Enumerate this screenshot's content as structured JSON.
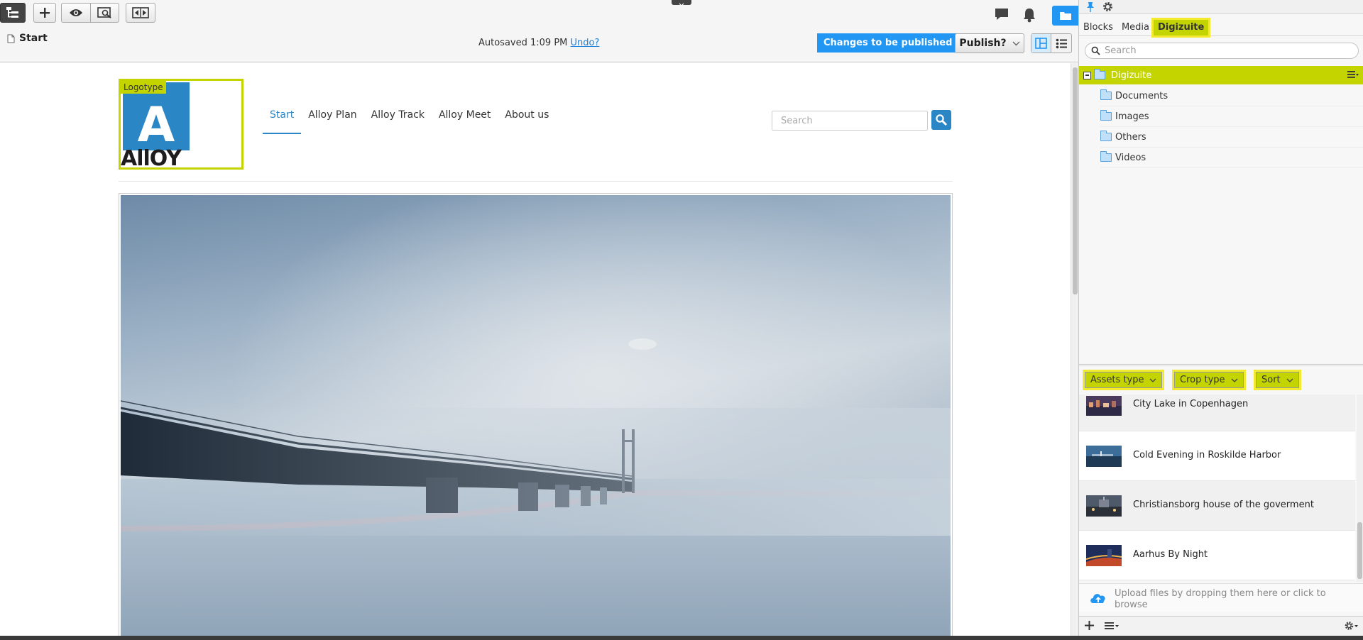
{
  "toolbar": {
    "breadcrumb": "Start",
    "autosaved_text": "Autosaved 1:09 PM",
    "undo_link": "Undo?",
    "changes_badge": "Changes to be published",
    "publish_label": "Publish?",
    "icons": [
      "tree-icon",
      "plus-icon",
      "eye-icon",
      "preview-icon",
      "compare-icon",
      "comment-icon",
      "bell-icon",
      "folder-icon",
      "layout-icon",
      "list-icon",
      "chevron-down-icon"
    ]
  },
  "site": {
    "logo_label": "Logotype",
    "logo_letter": "A",
    "logo_word": "AllOY",
    "nav": [
      "Start",
      "Alloy Plan",
      "Alloy Track",
      "Alloy Meet",
      "About us"
    ],
    "active_nav": "Start",
    "search_placeholder": "Search"
  },
  "panel": {
    "tabs": [
      "Blocks",
      "Media",
      "Digizuite"
    ],
    "active_tab": "Digizuite",
    "search_placeholder": "Search",
    "tree_root": "Digizuite",
    "tree_items": [
      "Documents",
      "Images",
      "Others",
      "Videos"
    ],
    "filters": [
      "Assets type",
      "Crop type",
      "Sort"
    ],
    "assets": [
      {
        "title": "City Lake in Copenhagen"
      },
      {
        "title": "Cold Evening in Roskilde Harbor"
      },
      {
        "title": "Christiansborg house of the goverment"
      },
      {
        "title": "Aarhus By Night"
      }
    ],
    "upload_text": "Upload files by dropping them here or click to browse"
  },
  "colors": {
    "accent_blue": "#2196f3",
    "highlight_green": "#c3d400",
    "highlight_yellow": "#f2ea2e",
    "alloy_blue": "#2b86c5"
  }
}
